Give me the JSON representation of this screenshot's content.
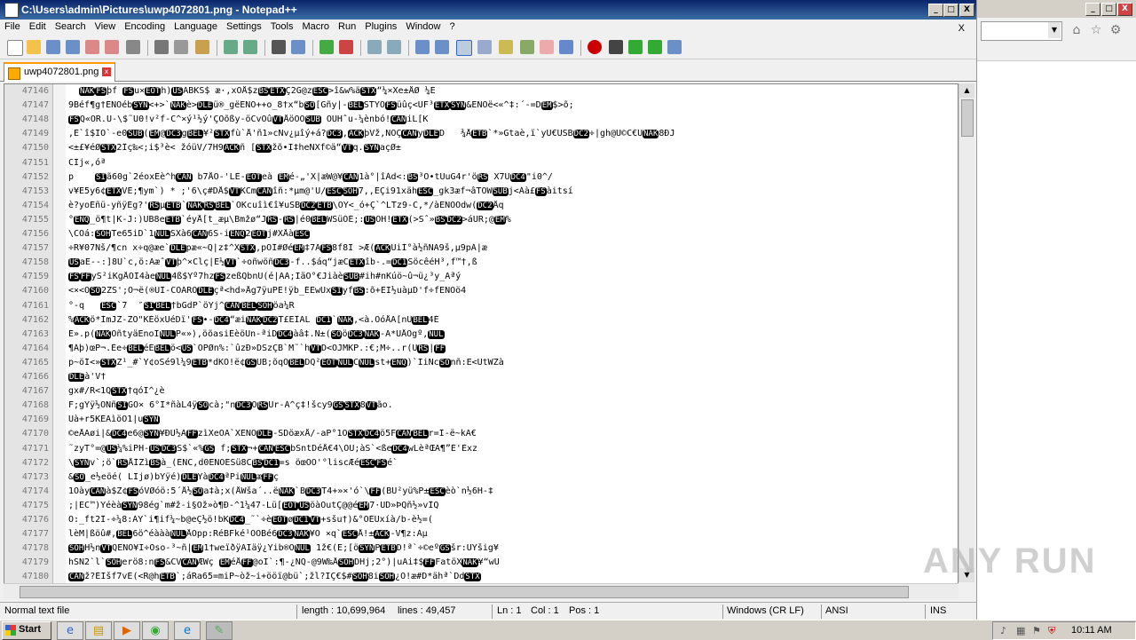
{
  "window": {
    "title": "C:\\Users\\admin\\Pictures\\uwp4072801.png - Notepad++",
    "minimize": "_",
    "maximize": "□",
    "close": "X"
  },
  "menu": {
    "items": [
      "File",
      "Edit",
      "Search",
      "View",
      "Encoding",
      "Language",
      "Settings",
      "Tools",
      "Macro",
      "Run",
      "Plugins",
      "Window",
      "?"
    ],
    "close_doc": "X"
  },
  "tab": {
    "label": "uwp4072801.png"
  },
  "editor": {
    "lines": [
      {
        "n": "47146",
        "t": "  NAKFSþf FSu×EOTh)USABKS$ æ·,xOÅ$zBSETXÇ2G@zESC>î&w%äSTX“¼×Xe±ÅØ ¼E"
      },
      {
        "n": "47147",
        "t": "9Béf¶g†ENOébSYN<+>`NAKè>DLEü®_gëENO++o_8†x“bSO[Gñy|-BELSTYÕFSüûç<UF³ETXSYN&ENOë<«^‡:´-=DEM$>õ;"
      },
      {
        "n": "47148",
        "t": "FSQ«ÖR.Ü-\\$˜Û0!v²f-C^×ý¹½ý'ÇOõßy-öCvÔûVTÅöOOSUB OÛHˆu-¼ènbó!CANiL[K"
      },
      {
        "n": "47149",
        "t": ",È`î$IÖ`-e0SUB(EM@DC3gBEL¥²STXfù`Å'ñ1»cNv¿µîý+á?DC3,ACKþVž,NOÇCANyDLED   ¾ÅETB`*»Gtaè,ï`yÜ€ÛSBDC2÷|gh@Ü©C€ÛNAK8ÐJ"
      },
      {
        "n": "47150",
        "t": "<±£¥éØSTX2Îç‰<;i$³è< žóüV/7H9ACKñ [STXžõ•Ï‡heÑXf©ä“VTq.SYNaçØ±"
      },
      {
        "n": "47151",
        "t": "CIj«,óª"
      },
      {
        "n": "47152",
        "t": "p    SIã60g`2éoxÊè^hCAN b7ÅÓ-'LÈ-EOTeà EMé-„'X|æW@¥CAN1à°|îÀd<:BS³Ó•tÛuG4r'öRS X7ÛDC4\"i0^/"
      },
      {
        "n": "47153",
        "t": "v¥E5y6¢ETXVE;¶ym`) * ;'6\\ç#DÅ$VTKCmCANîñ:*µm@'Ü/ESCSOH7,,ÉÇi91xähESC_gk3æf¬âTOWSUBj<Áà£FSàitsí"
      },
      {
        "n": "47154",
        "t": "è?yoÉñü-yñÿÉg?'RSµETB`NAKRSBEL`ÓKcuîì€î¥uSBDC2ETB\\ÓY<_ó+Ç`^LTz9-C,*/àENOOdw(DC2Åq"
      },
      {
        "n": "47155",
        "t": "°ENQ_ö¶t|K-J:)ÛB8eETB`éyÅ[t_æµ\\Bmžø“JRS-RS|é0BELWŠüÖÉ;:USOH!ETX(>Sˆ»BSDC2>áÛR;@EM%"
      },
      {
        "n": "47156",
        "t": "\\CÓá:SOHTe65iD`1NULŠXà6CAN6S-iENQ2EOTj#XÅàESC"
      },
      {
        "n": "47157",
        "t": "÷R¥07Nš/¶cn x÷q@æe`DLEpæ«~Q|z‡^XSTX,pÓÍ#ØéEM‡7ÃFS8f8I >Æ(ACKÜiÍ°à½ñNA9š,µ9pÁ|æ"
      },
      {
        "n": "47158",
        "t": "USaË--:]8Ü`c,ö:ÄæˆVTþ^×Clç|E½VT`÷oñwöñDC3-f..$áq“jæCETXîb-.=DC1SöcêéH³,f™†,ß"
      },
      {
        "n": "47159",
        "t": "FSFFyS²iKgÅÖI4àeNUL4ß$Yº7hzFSzeßQbnÜ(é|AÀ;IäÖ°€JiàèSUB#ih#nKúö~û¬ü¿³y_Äªý"
      },
      {
        "n": "47160",
        "t": "<×<ÖSO2ZŠ';Ô¬ë(®UI-COÁRÖDLEçª<hd»Åg7ÿuPË!ÿb_ÉËwÛxSIyfBS:õ+ÈI½uàµD'f÷fENOö4"
      },
      {
        "n": "47161",
        "t": "°-q   ESC`7  ″SIBEL†bGdP`öYj^CANBELSOHöa¼R"
      },
      {
        "n": "47162",
        "t": "%ACKö*ÌmJZ-ZÖ\"KÉöxUéDï'FS•-DC4“æiNAKDC2T£ËÎAL DC1`NAK,<à.ÓóÅÄ[nÜBEL4É"
      },
      {
        "n": "47163",
        "t": "É».p(NAKÖñtyäEnoÏNULP«»),öõasiÉèöÛn-ªiDDC4àâ‡.N±(SOöDC3NAK-Ä*ÜÅOgº,NUL"
      },
      {
        "n": "47164",
        "t": "¶Áþ)œP¬.Èe÷BELéÉBELö<US`ÖPØn%:`ûzÐ»DSzÇB`M˜`hVTD<ÔJMKP.:€;M÷..r(URS|FF"
      },
      {
        "n": "47165",
        "t": "p~öÍ<»STXZ¹_#`Y¢oŠé9l¼9ETB*dKÖ!ë¢GSUB;õqOBELDQ²EOTNULCNULst+ENQ)`IiNcSOnñ:E<ÛtWZà"
      },
      {
        "n": "47166",
        "t": "DLEà'V†"
      },
      {
        "n": "47167",
        "t": "gx#/R<1QSTX†qóI^¿è"
      },
      {
        "n": "47168",
        "t": "F;gYÿ½ONñSIGÖ× 6°I*ñàL4ÿSOcà;\"nDC3ORSUr-À^ç‡!šcy9GSSTX8VTão."
      },
      {
        "n": "47169",
        "t": "Üà+r5KÉÀìöÖ1|uSYN"
      },
      {
        "n": "47170",
        "t": "©eÅÄøi|&DC4e6@SYN¥ÐU½ÄFFzìXeÖA`XENODLE-ŠDöæxÅ/-aP°1OSTXDC4ö5FCANBELr=Î-ë~kÄ€"
      },
      {
        "n": "47171",
        "t": "˜zyT°=@US¼%iPH-USDC3S$`«%GS f;STX¬+CANESCbŠntDéÅ€4\\ÖÜ;àŠ`<ßeDC4wLèªŒÄ¶”É'Èxz"
      },
      {
        "n": "47172",
        "t": "\\SYNv`;ö`RSÅÍZìBSà_(ENC,d0ENOESü8CBSDC1=s öœÖÖ'°liscÆéESCFSé`"
      },
      {
        "n": "47173",
        "t": "&SO_e½eöé( LIjø)bYÿé)DLEYàDC4ªPiNULæFFç"
      },
      {
        "n": "47174",
        "t": "1ÖàyCANà$Z¢FSóVØóö:5´Å½SOa‡à;x(ÅWša´..ëNAK`BDC3T4+»×'ó`\\FF(BU²yü%P±ESCèò`n½6H-‡"
      },
      {
        "n": "47175",
        "t": ";|EC™)YéèàSYN98ég`m#ž-i§Ož»ò¶Ð-^1¼47-Lü[EOTUSöàÖutÇ@@éEM7·ÛD»ÞQñ½»vÎQ"
      },
      {
        "n": "47176",
        "t": "Ö:_ft2Î-÷¼8:ÀY`i¶if¼~b@eÇ½ö!bKDC4_˜`÷èEOTøDC1VT+sšu†)&°ÖÉÛxíà/b-è½=("
      },
      {
        "n": "47177",
        "t": "lèM|ßöû#,BEL6ö^éàààNULÅÖpp:RéBFké¹ÖOBé6DC3NAK¥Ö ×q`ESCÅ!±ACK-V¶z:Àµ"
      },
      {
        "n": "47178",
        "t": "SOHH½nVTQENO¥I÷Öso-³~ñ|EM1†weïðÿÄIäÿ¿Yib®ONUL 1ž€(E;[öSYNPETBD!ª`÷©eºGSšr:ÛYšig¥"
      },
      {
        "n": "47179",
        "t": "hSN2`l`SOHerö8:nFS&CVCANÆWç EMéÅFF@oI`:¶-¿ÑQ-@9W‰ÅSOHDHj;2°)|uÄi‡$FFFatöXNAK¥“wU"
      },
      {
        "n": "47180",
        "t": "CANž?ÈIšf7vÉ(<R@hETB`;áRa65=miP~òž~i+ööï@bü`;žl?IÇ€$#SOH8iSOH¿O!æ#D*ähª`DdSTX"
      }
    ]
  },
  "status": {
    "type": "Normal text file",
    "length": "length : 10,699,964",
    "lines": "lines : 49,457",
    "ln": "Ln : 1",
    "col": "Col : 1",
    "pos": "Pos : 1",
    "eol": "Windows (CR LF)",
    "encoding": "ANSI",
    "mode": "INS"
  },
  "browser": {
    "minimize": "_",
    "maximize": "□",
    "close": "X"
  },
  "taskbar": {
    "start_label": "Start",
    "clock": "10:11 AM"
  },
  "watermark": "ANY RUN"
}
